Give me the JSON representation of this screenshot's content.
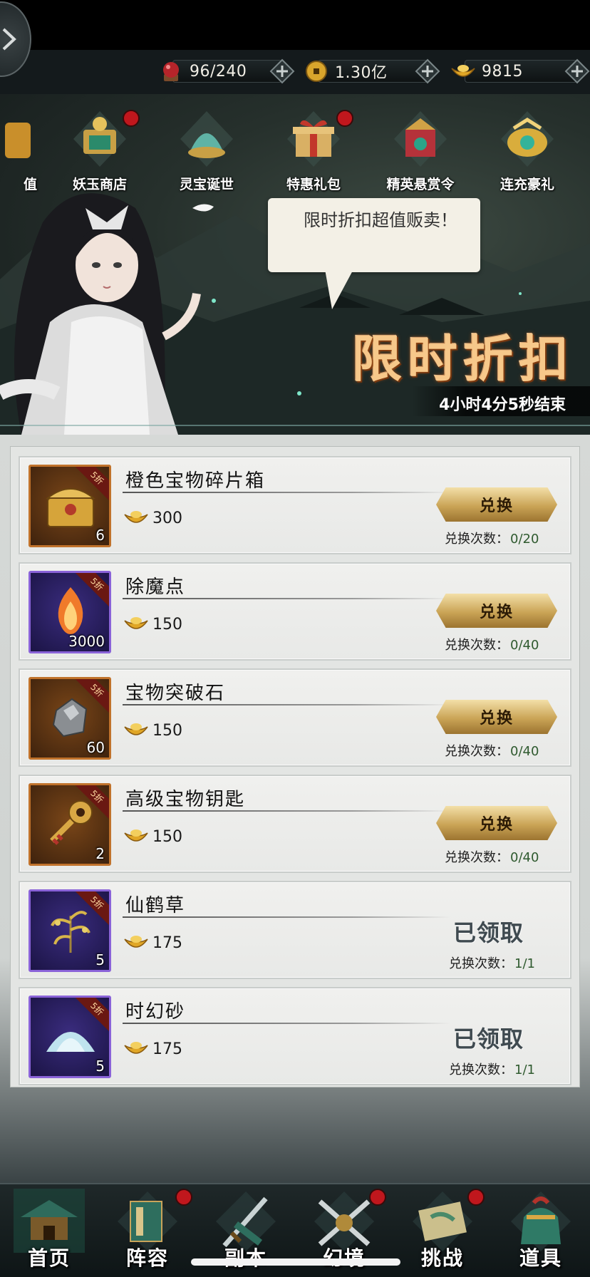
{
  "top_bar": {
    "resources": [
      {
        "name": "stamina",
        "icon": "red-orb-icon",
        "value": "96/240"
      },
      {
        "name": "coins",
        "icon": "coin-icon",
        "value": "1.30亿"
      },
      {
        "name": "ingots",
        "icon": "gold-ingot-icon",
        "value": "9815"
      }
    ]
  },
  "banner": {
    "shop_tabs": [
      {
        "label": "值",
        "icon": "partial-shop-icon",
        "dot": false
      },
      {
        "label": "妖玉商店",
        "icon": "jade-shop-icon",
        "dot": true
      },
      {
        "label": "灵宝诞世",
        "icon": "spirit-treasure-icon",
        "dot": false
      },
      {
        "label": "特惠礼包",
        "icon": "gift-box-icon",
        "dot": true
      },
      {
        "label": "精英悬赏令",
        "icon": "bounty-icon",
        "dot": false
      },
      {
        "label": "连充豪礼",
        "icon": "recharge-gift-icon",
        "dot": false
      }
    ],
    "speech": "限时折扣超值贩卖！",
    "title": "限时折扣",
    "timer": "4小时4分5秒结束"
  },
  "list": {
    "count_label": "兑换次数：",
    "exchange_label": "兑换",
    "claimed_label": "已领取",
    "items": [
      {
        "name": "橙色宝物碎片箱",
        "badge": "5折",
        "qty": "6",
        "price": "300",
        "count": "0/20",
        "rarity": "orange",
        "icon": "treasure-chest-icon",
        "claimed": false
      },
      {
        "name": "除魔点",
        "badge": "5折",
        "qty": "3000",
        "price": "150",
        "count": "0/40",
        "rarity": "purple",
        "icon": "flame-icon",
        "claimed": false
      },
      {
        "name": "宝物突破石",
        "badge": "5折",
        "qty": "60",
        "price": "150",
        "count": "0/40",
        "rarity": "orange",
        "icon": "ore-stone-icon",
        "claimed": false
      },
      {
        "name": "高级宝物钥匙",
        "badge": "5折",
        "qty": "2",
        "price": "150",
        "count": "0/40",
        "rarity": "orange",
        "icon": "key-icon",
        "claimed": false
      },
      {
        "name": "仙鹤草",
        "badge": "5折",
        "qty": "5",
        "price": "175",
        "count": "1/1",
        "rarity": "purple",
        "icon": "herb-icon",
        "claimed": true
      },
      {
        "name": "时幻砂",
        "badge": "5折",
        "qty": "5",
        "price": "175",
        "count": "1/1",
        "rarity": "purple",
        "icon": "sand-pile-icon",
        "claimed": true
      }
    ]
  },
  "bottom_nav": [
    {
      "label": "首页",
      "icon": "pavilion-icon",
      "dot": false
    },
    {
      "label": "阵容",
      "icon": "lineup-book-icon",
      "dot": true
    },
    {
      "label": "副本",
      "icon": "sword-icon",
      "dot": false
    },
    {
      "label": "幻境",
      "icon": "crossed-swords-icon",
      "dot": true
    },
    {
      "label": "挑战",
      "icon": "scroll-map-icon",
      "dot": true
    },
    {
      "label": "道具",
      "icon": "item-bag-icon",
      "dot": false
    }
  ],
  "colors": {
    "accent_gold": "#caa456",
    "badge_red": "#c0171d",
    "title_orange": "#f7c88a"
  }
}
